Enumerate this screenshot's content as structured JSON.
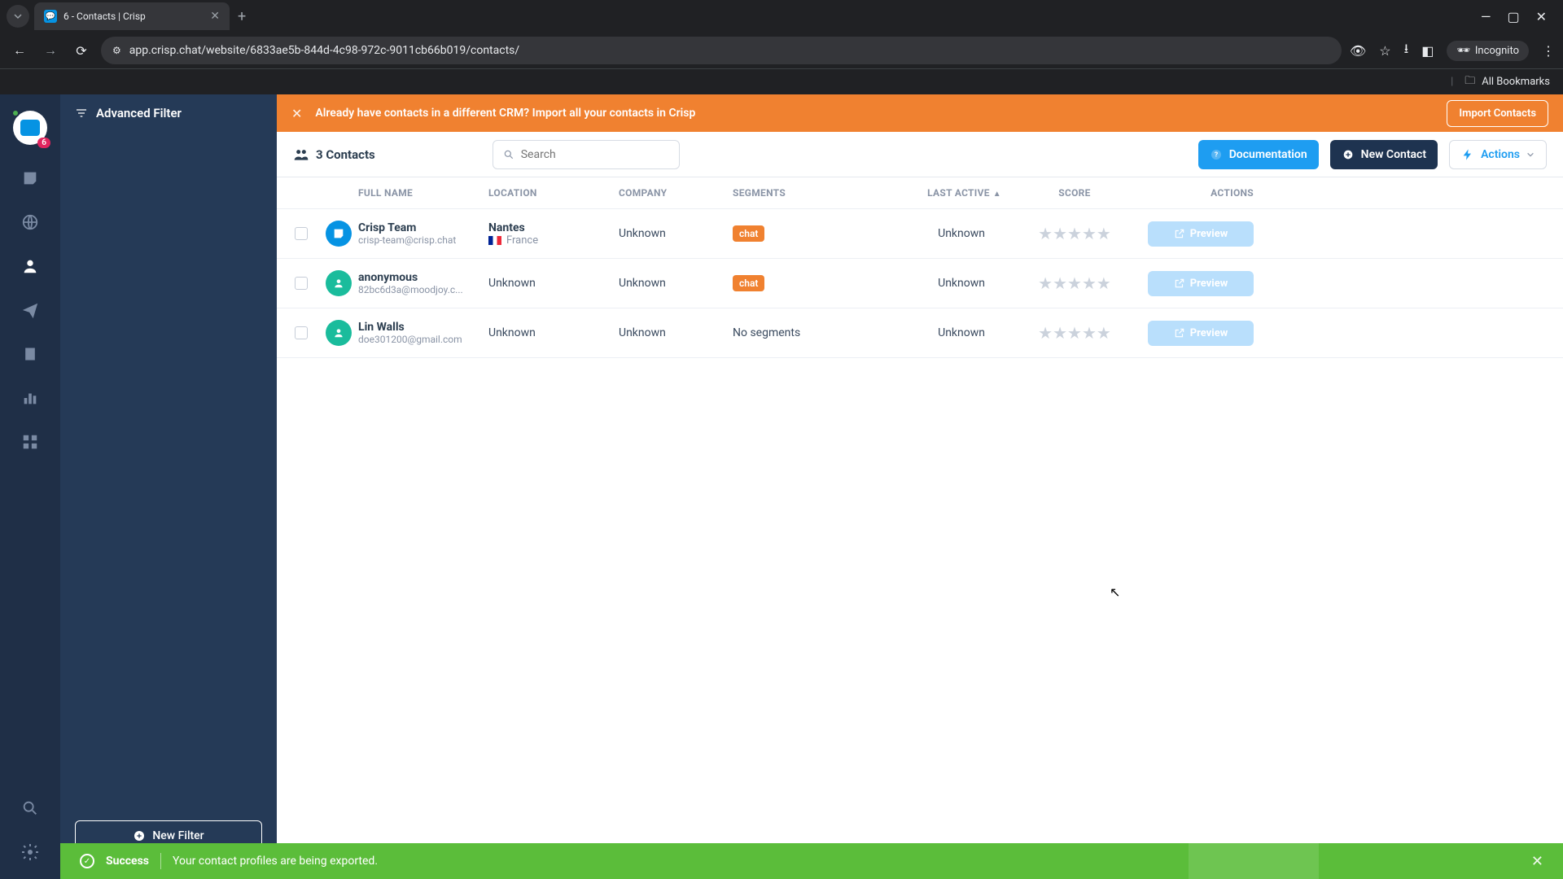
{
  "browser": {
    "tab_title": "6 - Contacts | Crisp",
    "url": "app.crisp.chat/website/6833ae5b-844d-4c98-972c-9011cb66b019/contacts/",
    "incognito": "Incognito",
    "all_bookmarks": "All Bookmarks"
  },
  "sidebar": {
    "badge": "6"
  },
  "filter": {
    "title": "Advanced Filter",
    "new_filter": "New Filter"
  },
  "banner": {
    "message": "Already have contacts in a different CRM? Import all your contacts in Crisp",
    "import_btn": "Import Contacts"
  },
  "toolbar": {
    "count_label": "3 Contacts",
    "search_placeholder": "Search",
    "documentation": "Documentation",
    "new_contact": "New Contact",
    "actions": "Actions"
  },
  "table": {
    "headers": {
      "full_name": "FULL NAME",
      "location": "LOCATION",
      "company": "COMPANY",
      "segments": "SEGMENTS",
      "last_active": "LAST ACTIVE",
      "score": "SCORE",
      "actions": "ACTIONS"
    },
    "preview_label": "Preview",
    "no_segments": "No segments",
    "unknown": "Unknown",
    "rows": [
      {
        "name": "Crisp Team",
        "email": "crisp-team@crisp.chat",
        "avatar_color": "blue",
        "city": "Nantes",
        "country": "France",
        "company": "Unknown",
        "segment_tag": "chat",
        "last_active": "Unknown"
      },
      {
        "name": "anonymous",
        "email": "82bc6d3a@moodjoy.c...",
        "avatar_color": "teal",
        "city": "",
        "country": "Unknown",
        "company": "Unknown",
        "segment_tag": "chat",
        "last_active": "Unknown"
      },
      {
        "name": "Lin Walls",
        "email": "doe301200@gmail.com",
        "avatar_color": "teal",
        "city": "",
        "country": "Unknown",
        "company": "Unknown",
        "segment_tag": "",
        "last_active": "Unknown"
      }
    ]
  },
  "toast": {
    "title": "Success",
    "message": "Your contact profiles are being exported."
  }
}
